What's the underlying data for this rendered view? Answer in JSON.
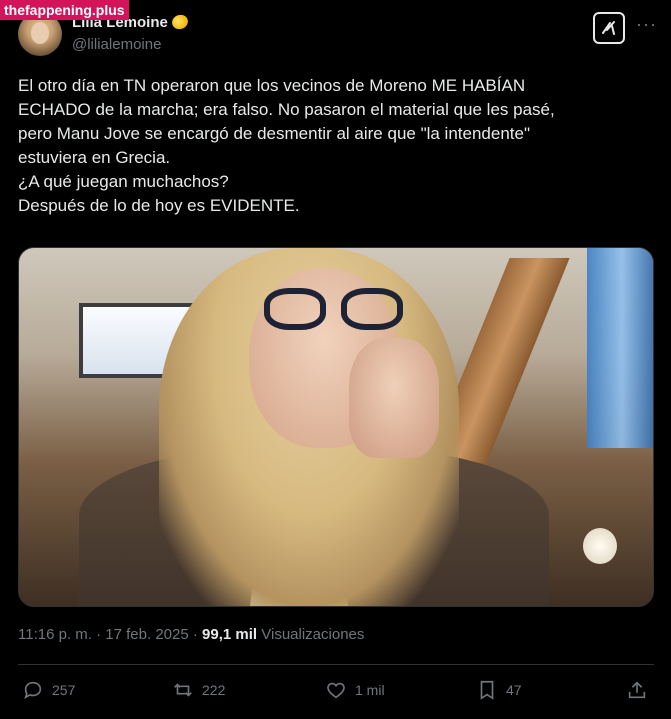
{
  "watermark": "thefappening.plus",
  "author": {
    "display_name": "Lilia Lemoine",
    "handle": "@lilialemoine",
    "emoji_icon": "lemon-icon"
  },
  "header_actions": {
    "grok_icon": "grok-icon",
    "more_icon": "more-icon",
    "more_label": "···"
  },
  "tweet": {
    "lines": [
      "El otro día en TN operaron que los vecinos de Moreno ME HABÍAN",
      "ECHADO de la marcha; era falso. No pasaron el material que les pasé,",
      "pero Manu Jove se encargó de desmentir al aire que  \"la intendente\"",
      "estuviera en Grecia.",
      "¿A qué juegan muchachos?",
      "Después de lo de hoy es EVIDENTE."
    ]
  },
  "meta": {
    "time": "11:16 p. m.",
    "separator1": " · ",
    "date": "17 feb. 2025",
    "separator2": " · ",
    "views_count": "99,1 mil",
    "views_label": " Visualizaciones"
  },
  "actions": {
    "replies": "257",
    "reposts": "222",
    "likes": "1 mil",
    "bookmarks": "47"
  },
  "colors": {
    "background": "#000000",
    "text": "#e7e9ea",
    "muted": "#71767b",
    "divider": "#2f3336"
  }
}
